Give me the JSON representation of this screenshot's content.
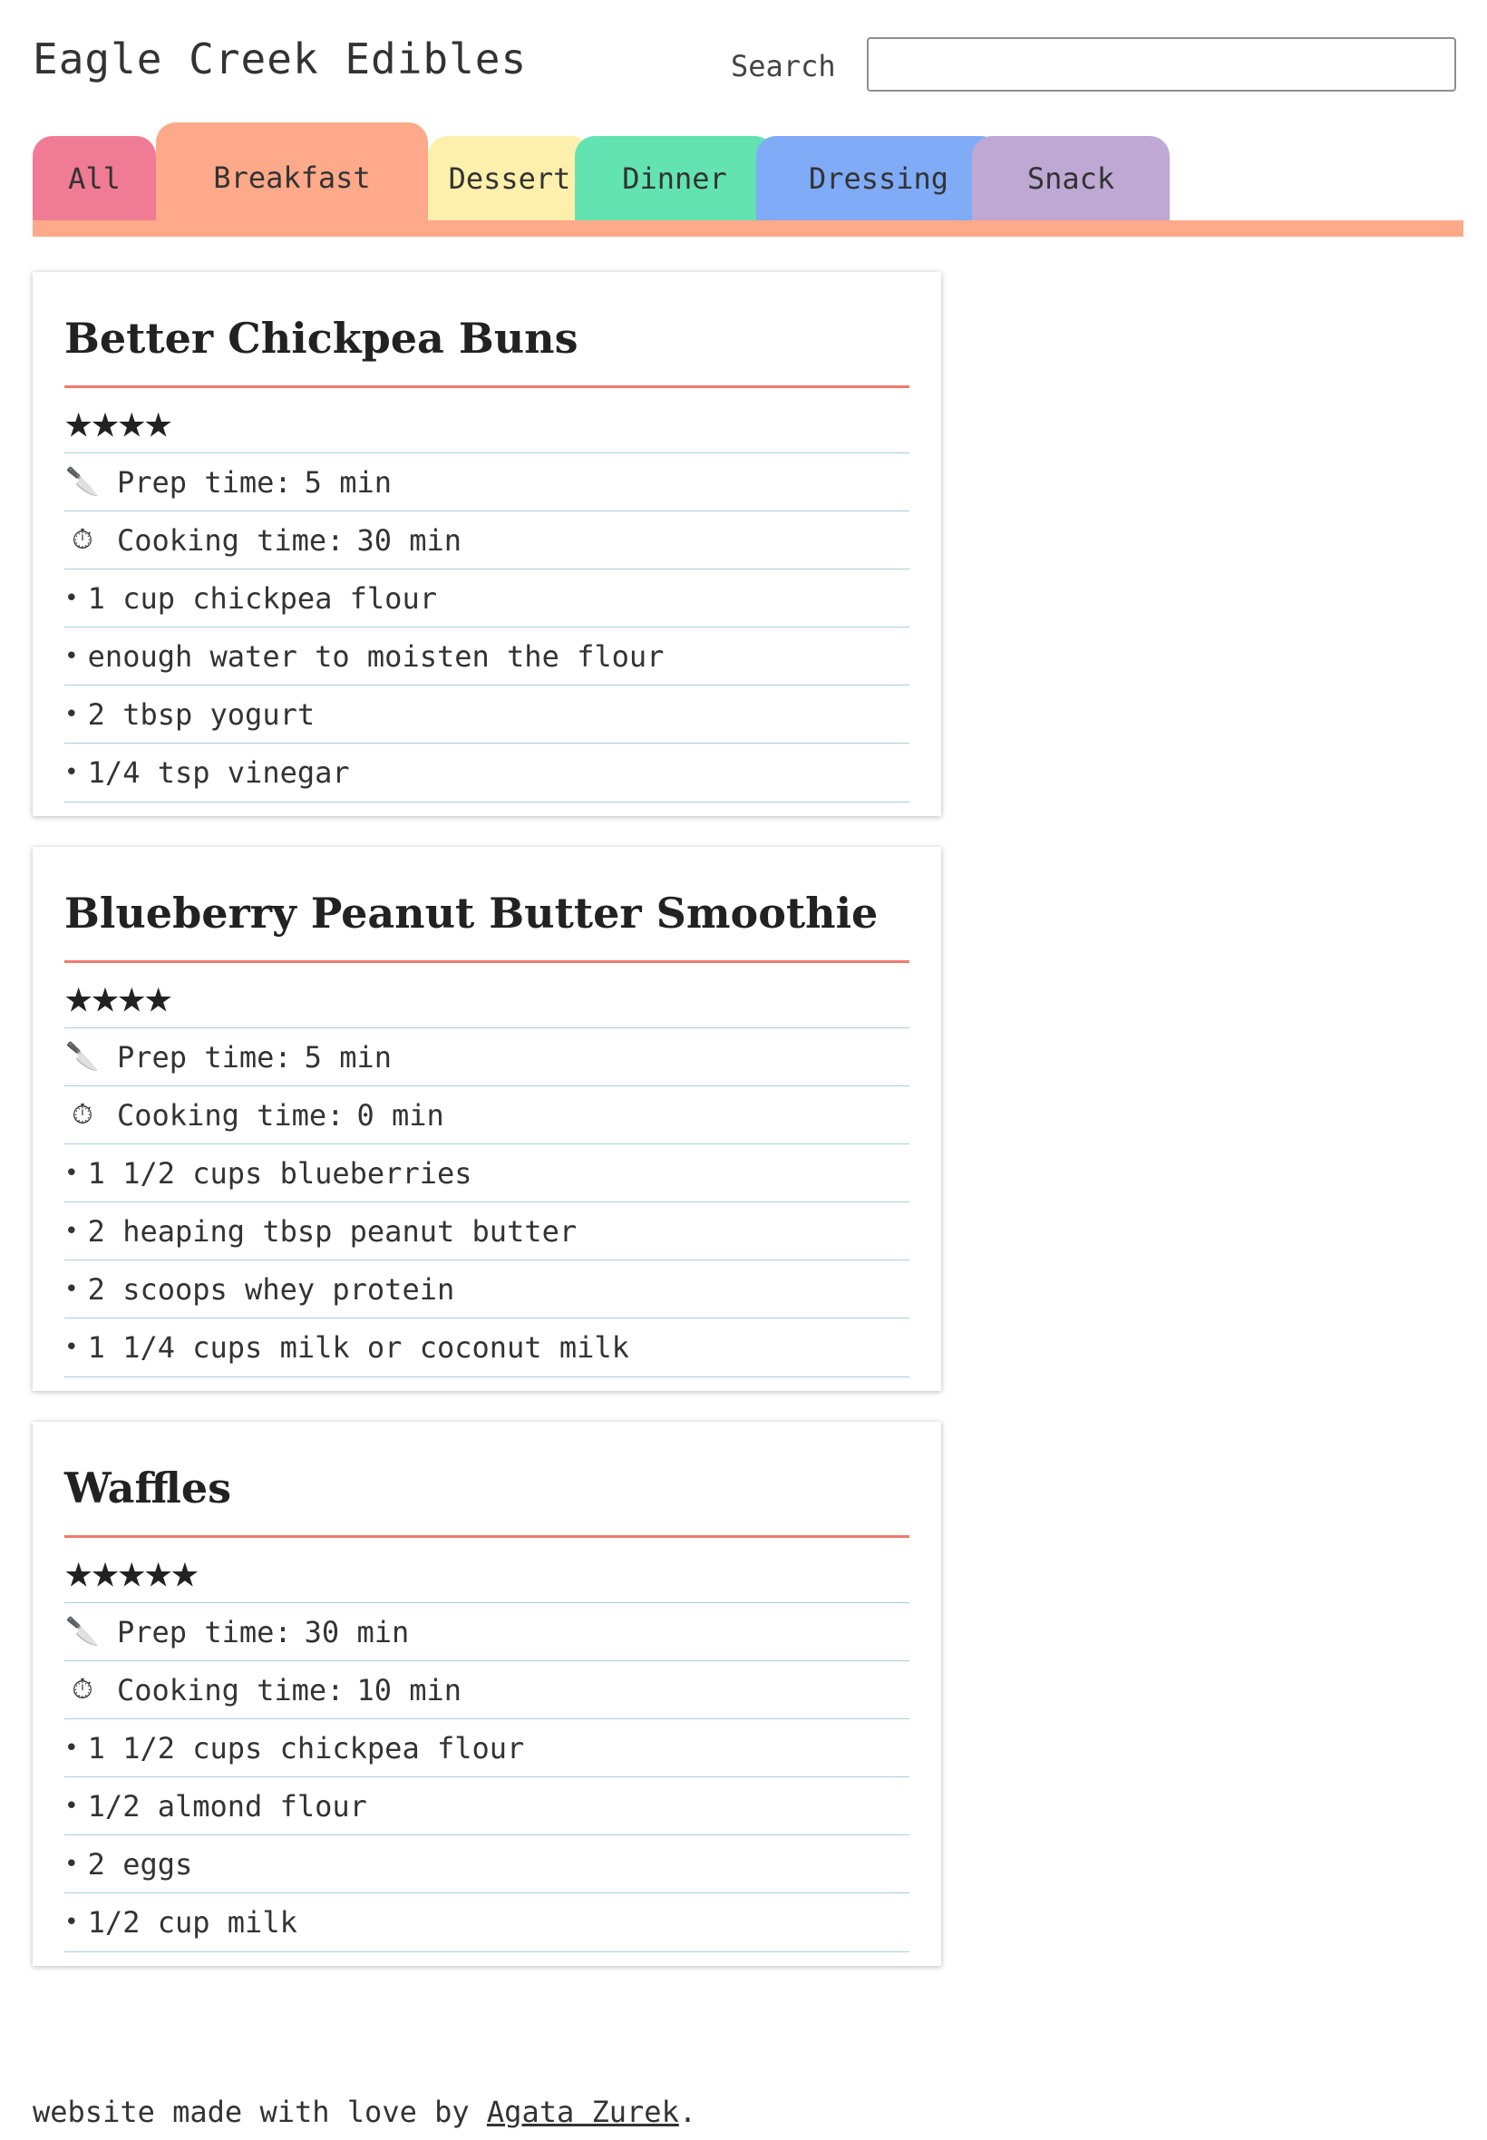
{
  "site": {
    "title": "Eagle Creek Edibles"
  },
  "search": {
    "label": "Search",
    "value": "",
    "placeholder": ""
  },
  "tabs": [
    {
      "label": "All",
      "color": "#f07b94",
      "active": false
    },
    {
      "label": "Breakfast",
      "color": "#fda98a",
      "active": true
    },
    {
      "label": "Dessert",
      "color": "#fdf0ad",
      "active": false
    },
    {
      "label": "Dinner",
      "color": "#62e3b1",
      "active": false
    },
    {
      "label": "Dressing",
      "color": "#7fabf7",
      "active": false
    },
    {
      "label": "Snack",
      "color": "#bfa8d4",
      "active": false
    }
  ],
  "colors": {
    "active_bar": "#fda98a",
    "title_rule": "#f07a6d",
    "row_line": "#a9cfe0"
  },
  "recipes": [
    {
      "title": "Better Chickpea Buns",
      "rating": 4,
      "prep_label": "Prep time:",
      "prep_value": "5 min",
      "cook_label": "Cooking time:",
      "cook_value": "30 min",
      "ingredients": [
        "1 cup chickpea flour",
        "enough water to moisten the flour",
        "2 tbsp yogurt",
        "1/4 tsp vinegar"
      ]
    },
    {
      "title": "Blueberry Peanut Butter Smoothie",
      "rating": 4,
      "prep_label": "Prep time:",
      "prep_value": "5 min",
      "cook_label": "Cooking time:",
      "cook_value": "0 min",
      "ingredients": [
        "1 1/2 cups blueberries",
        "2 heaping tbsp peanut butter",
        "2 scoops whey protein",
        "1 1/4 cups milk or coconut milk"
      ]
    },
    {
      "title": "Waffles",
      "rating": 5,
      "prep_label": "Prep time:",
      "prep_value": "30 min",
      "cook_label": "Cooking time:",
      "cook_value": "10 min",
      "ingredients": [
        "1 1/2 cups chickpea flour",
        "1/2 almond flour",
        "2 eggs",
        "1/2 cup milk"
      ]
    }
  ],
  "icons": {
    "prep": "knife-icon",
    "cook": "stopwatch-icon",
    "rating": "star-icon"
  },
  "footer": {
    "text": "website made with love by ",
    "author": "Agata Zurek",
    "end": "."
  }
}
